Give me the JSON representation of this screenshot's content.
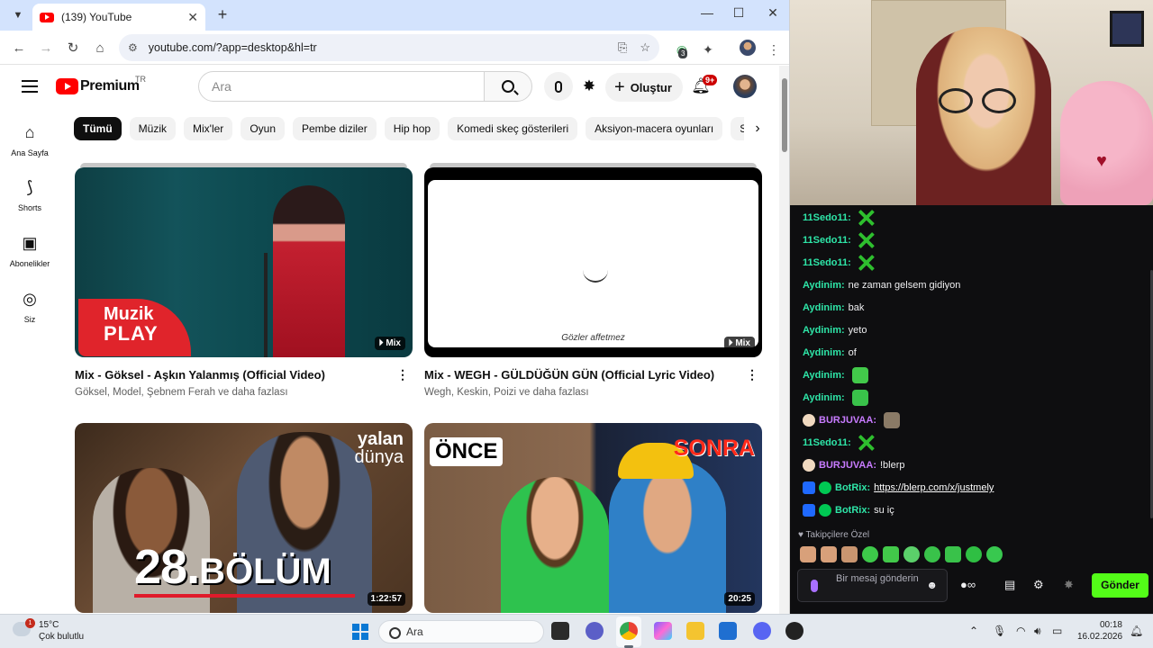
{
  "browser": {
    "tab_title": "(139) YouTube",
    "url": "youtube.com/?app=desktop&hl=tr",
    "extension_badge": "3"
  },
  "youtube": {
    "logo_text": "Premium",
    "country_code": "TR",
    "search_placeholder": "Ara",
    "create_label": "Oluştur",
    "notification_count": "9+",
    "guide": [
      {
        "label": "Ana Sayfa",
        "icon": "home-icon"
      },
      {
        "label": "Shorts",
        "icon": "shorts-icon"
      },
      {
        "label": "Abonelikler",
        "icon": "subscriptions-icon"
      },
      {
        "label": "Siz",
        "icon": "you-icon"
      }
    ],
    "chips": [
      "Tümü",
      "Müzik",
      "Mix'ler",
      "Oyun",
      "Pembe diziler",
      "Hip hop",
      "Komedi skeç gösterileri",
      "Aksiyon-macera oyunları",
      "Sc"
    ],
    "videos": [
      {
        "title": "Mix - Göksel - Aşkın Yalanmış (Official Video)",
        "subtitle": "Göksel, Model, Şebnem Ferah ve daha fazlası",
        "badge": "Mix",
        "thumb_text_1": "Muzik",
        "thumb_text_2": "PLAY"
      },
      {
        "title": "Mix - WEGH - GÜLDÜĞÜN GÜN (Official Lyric Video)",
        "subtitle": "Wegh, Keskin, Poizi ve daha fazlası",
        "badge": "Mix",
        "thumb_caption": "Gözler affetmez"
      },
      {
        "duration": "1:22:57",
        "thumb_brand_1": "yalan",
        "thumb_brand_2": "dünya",
        "thumb_episode_num": "28.",
        "thumb_episode_word": "BÖLÜM"
      },
      {
        "duration": "20:25",
        "thumb_left": "ÖNCE",
        "thumb_right": "SONRA"
      }
    ]
  },
  "chat": {
    "messages": [
      {
        "user": "11Sedo11",
        "color": "green",
        "text": "",
        "emote": "x"
      },
      {
        "user": "11Sedo11",
        "color": "green",
        "text": "",
        "emote": "x"
      },
      {
        "user": "11Sedo11",
        "color": "green",
        "text": "",
        "emote": "x"
      },
      {
        "user": "Aydinim",
        "color": "green",
        "text": "ne zaman gelsem gidiyon"
      },
      {
        "user": "Aydinim",
        "color": "green",
        "text": "bak"
      },
      {
        "user": "Aydinim",
        "color": "green",
        "text": "yeto"
      },
      {
        "user": "Aydinim",
        "color": "green",
        "text": "of"
      },
      {
        "user": "Aydinim",
        "color": "green",
        "text": "",
        "emote": "sq"
      },
      {
        "user": "Aydinim",
        "color": "green",
        "text": "",
        "emote": "blob"
      },
      {
        "user": "BURJUVAA",
        "color": "purple",
        "text": "",
        "emote": "cat"
      },
      {
        "user": "11Sedo11",
        "color": "green",
        "text": "",
        "emote": "x"
      },
      {
        "user": "BURJUVAA",
        "color": "purple",
        "text": "!blerp"
      },
      {
        "user": "BotRix",
        "color": "green",
        "text": "https://blerp.com/x/justmely",
        "link": true
      },
      {
        "user": "BotRix",
        "color": "green",
        "text": "su iç"
      }
    ],
    "subscriber_emotes_label": "Takipçilere Özel",
    "input_placeholder": "Bir mesaj gönderin",
    "send_label": "Gönder"
  },
  "taskbar": {
    "weather_temp": "15°C",
    "weather_desc": "Çok bulutlu",
    "weather_badge": "1",
    "search_label": "Ara",
    "time": "00:18",
    "date": "16.02.2026"
  }
}
